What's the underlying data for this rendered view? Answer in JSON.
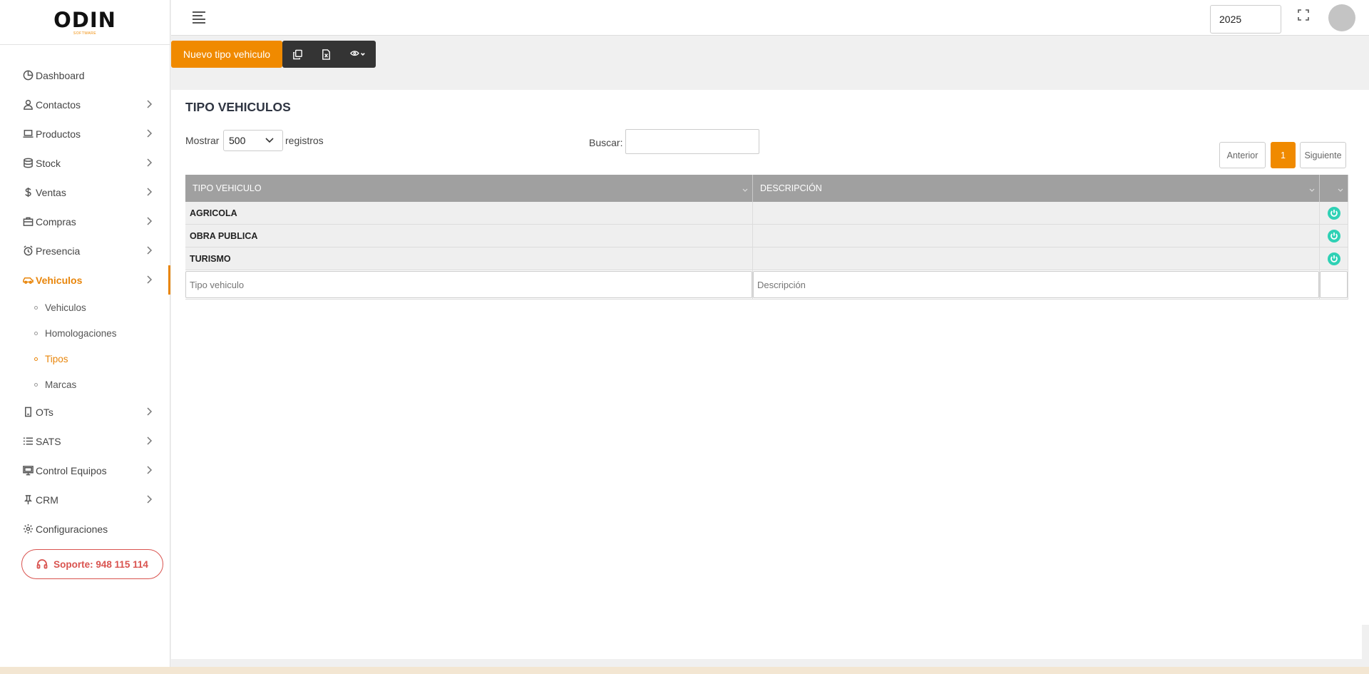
{
  "app": {
    "logo_text": "ODIN",
    "logo_sub": "SOFTWARE",
    "year": "2025"
  },
  "sidebar": {
    "items": [
      {
        "label": "Dashboard",
        "icon": "chart-pie-icon"
      },
      {
        "label": "Contactos",
        "icon": "user-icon"
      },
      {
        "label": "Productos",
        "icon": "laptop-icon"
      },
      {
        "label": "Stock",
        "icon": "database-icon"
      },
      {
        "label": "Ventas",
        "icon": "dollar-icon"
      },
      {
        "label": "Compras",
        "icon": "briefcase-icon"
      },
      {
        "label": "Presencia",
        "icon": "alarm-clock-icon"
      },
      {
        "label": "Vehiculos",
        "icon": "car-icon"
      },
      {
        "label": "OTs",
        "icon": "clipboard-icon"
      },
      {
        "label": "SATS",
        "icon": "list-icon"
      },
      {
        "label": "Control Equipos",
        "icon": "monitor-icon"
      },
      {
        "label": "CRM",
        "icon": "pin-icon"
      },
      {
        "label": "Configuraciones",
        "icon": "gear-icon"
      }
    ],
    "active": "Vehiculos",
    "subitems": [
      {
        "label": "Vehiculos"
      },
      {
        "label": "Homologaciones"
      },
      {
        "label": "Tipos"
      },
      {
        "label": "Marcas"
      }
    ],
    "active_subitem": "Tipos",
    "support_label": "Soporte: 948 115 114"
  },
  "toolbar": {
    "new_label": "Nuevo tipo vehiculo",
    "buttons": [
      "copy-icon",
      "excel-icon",
      "eye-icon"
    ]
  },
  "page": {
    "title": "TIPO VEHICULOS",
    "length_before": "Mostrar",
    "length_value": "500",
    "length_after": "registros",
    "search_label": "Buscar:",
    "search_value": "",
    "pagination": {
      "prev": "Anterior",
      "current": "1",
      "next": "Siguiente"
    }
  },
  "table": {
    "columns": [
      "TIPO VEHICULO",
      "DESCRIPCIÓN",
      ""
    ],
    "rows": [
      {
        "tipo": "AGRICOLA",
        "descripcion": ""
      },
      {
        "tipo": "OBRA PUBLICA",
        "descripcion": ""
      },
      {
        "tipo": "TURISMO",
        "descripcion": ""
      }
    ],
    "footer_placeholders": {
      "tipo": "Tipo vehiculo",
      "descripcion": "Descripción"
    }
  },
  "colors": {
    "accent": "#f08a00",
    "support": "#d9534f",
    "power": "#2fd1b5",
    "header_bg": "#a0a0a0"
  }
}
